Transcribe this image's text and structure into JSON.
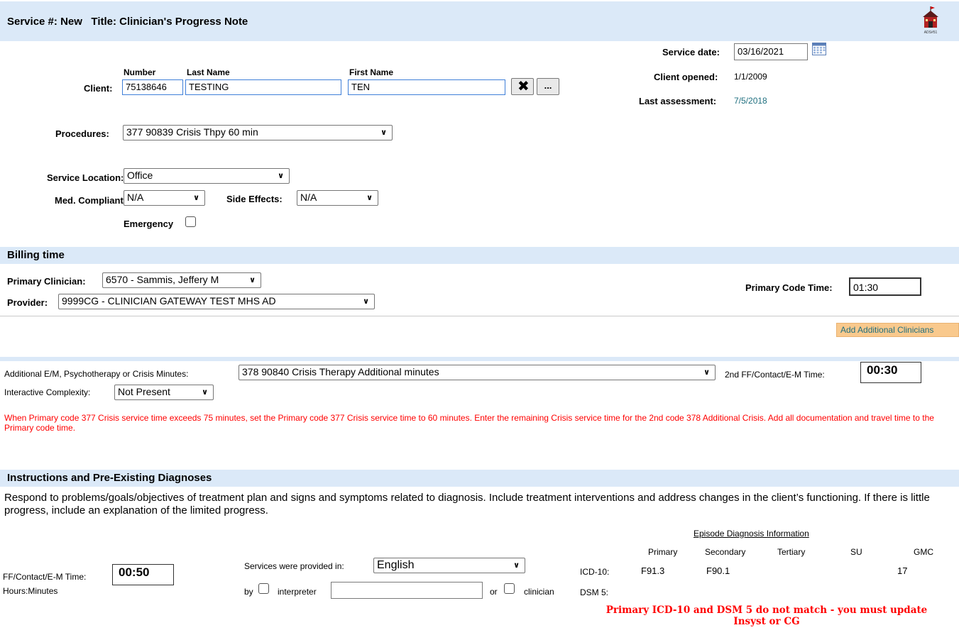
{
  "header": {
    "service_label": "Service #:",
    "service_value": "New",
    "title_label": "Title:",
    "title_value": "Clinician's Progress Note",
    "logo_icon": "schoolhouse-logo-icon",
    "logo_text": "ADS#51"
  },
  "service_info": {
    "service_date_label": "Service date:",
    "service_date_value": "03/16/2021",
    "calendar_icon": "calendar-icon",
    "client_opened_label": "Client opened:",
    "client_opened_value": "1/1/2009",
    "last_assessment_label": "Last assessment:",
    "last_assessment_value": "7/5/2018"
  },
  "client": {
    "label": "Client:",
    "number_header": "Number",
    "last_name_header": "Last Name",
    "first_name_header": "First Name",
    "number": "75138646",
    "last_name": "TESTING",
    "first_name": "TEN",
    "clear_icon": "close-x-icon",
    "more_label": "..."
  },
  "procedures": {
    "label": "Procedures:",
    "value": "377 90839 Crisis Thpy 60 min"
  },
  "location": {
    "label": "Service Location:",
    "value": "Office"
  },
  "med_compliant": {
    "label": "Med. Compliant:",
    "value": "N/A"
  },
  "side_effects": {
    "label": "Side Effects:",
    "value": "N/A"
  },
  "emergency": {
    "label": "Emergency",
    "checked": false
  },
  "billing": {
    "section_title": "Billing time",
    "primary_clinician_label": "Primary Clinician:",
    "primary_clinician_value": "6570 - Sammis, Jeffery M",
    "provider_label": "Provider:",
    "provider_value": "9999CG - CLINICIAN GATEWAY TEST MHS AD",
    "primary_code_time_label": "Primary Code Time:",
    "primary_code_time_value": "01:30",
    "add_clinicians_label": "Add Additional Clinicians"
  },
  "additional": {
    "minutes_label": "Additional E/M, Psychotherapy or Crisis Minutes:",
    "minutes_value": "378 90840 Crisis Therapy Additional minutes",
    "second_time_label": "2nd FF/Contact/E-M Time:",
    "second_time_value": "00:30",
    "complexity_label": "Interactive Complexity:",
    "complexity_value": "Not Present",
    "warning": "When Primary code 377 Crisis service time exceeds 75 minutes, set the Primary code 377 Crisis service time to 60 minutes. Enter the remaining Crisis service time for the 2nd code 378 Additional Crisis. Add all documentation and travel time to the Primary code time."
  },
  "instructions": {
    "section_title": "Instructions and Pre-Existing Diagnoses",
    "text": "Respond to problems/goals/objectives of treatment plan and signs and symptoms related to diagnosis. Include treatment interventions and address changes in the client’s functioning. If there is little progress, include an explanation of the limited progress."
  },
  "contact": {
    "time_label": "FF/Contact/E-M Time:",
    "time_value": "00:50",
    "hours_minutes": "Hours:Minutes",
    "services_label": "Services were provided in:",
    "language_value": "English",
    "by_label": "by",
    "interpreter_label": "interpreter",
    "interpreter_value": "",
    "or_label": "or",
    "clinician_label": "clinician"
  },
  "diagnosis": {
    "heading": "Episode Diagnosis Information",
    "columns": [
      "Primary",
      "Secondary",
      "Tertiary",
      "SU",
      "GMC"
    ],
    "icd10_label": "ICD-10:",
    "icd10_primary": "F91.3",
    "icd10_secondary": "F90.1",
    "icd10_gmc": "17",
    "dsm5_label": "DSM 5:",
    "mismatch_line1": "Primary ICD-10 and DSM 5 do not match - you must update",
    "mismatch_line2": "Insyst or CG"
  },
  "colors": {
    "section_bar": "#dbe9f8",
    "button_orange": "#f9c98d",
    "warning_red": "#ff0000",
    "teal_link": "#1f6f7f"
  }
}
